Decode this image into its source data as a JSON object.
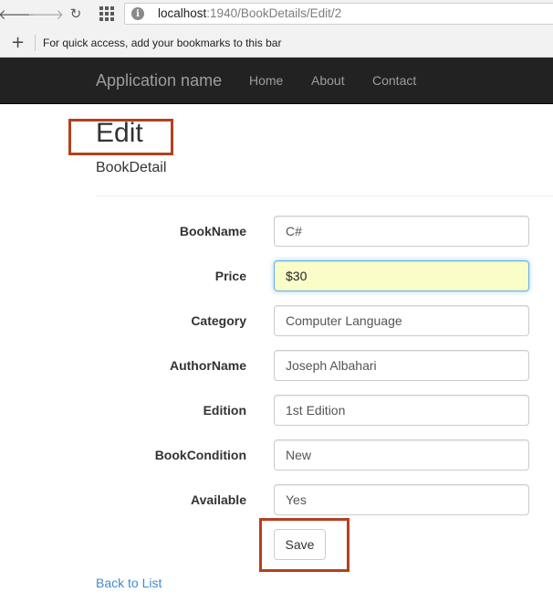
{
  "browser": {
    "back_icon": "back-arrow-icon",
    "forward_icon": "forward-arrow-icon",
    "reload_icon": "reload-icon",
    "apps_icon": "apps-grid-icon",
    "info_icon": "page-info-icon",
    "url_host": "localhost",
    "url_path": ":1940/BookDetails/Edit/2",
    "bookmarks_prompt": "For quick access, add your bookmarks to this bar",
    "add_bookmark_icon": "plus-icon"
  },
  "navbar": {
    "brand": "Application name",
    "links": [
      "Home",
      "About",
      "Contact"
    ],
    "background": "#222222",
    "text_color": "#9d9d9d"
  },
  "page": {
    "title": "Edit",
    "subtitle": "BookDetail"
  },
  "form": {
    "fields": [
      {
        "label": "BookName",
        "value": "C#"
      },
      {
        "label": "Price",
        "value": "$30"
      },
      {
        "label": "Category",
        "value": "Computer Language"
      },
      {
        "label": "AuthorName",
        "value": "Joseph Albahari"
      },
      {
        "label": "Edition",
        "value": "1st Edition"
      },
      {
        "label": "BookCondition",
        "value": "New"
      },
      {
        "label": "Available",
        "value": "Yes"
      }
    ],
    "focused_field": "Price",
    "save_label": "Save"
  },
  "footer": {
    "back_link": "Back to List"
  },
  "colors": {
    "highlight_border": "#b5401f",
    "link": "#428bca",
    "focused_input_bg": "#fafdc8"
  }
}
